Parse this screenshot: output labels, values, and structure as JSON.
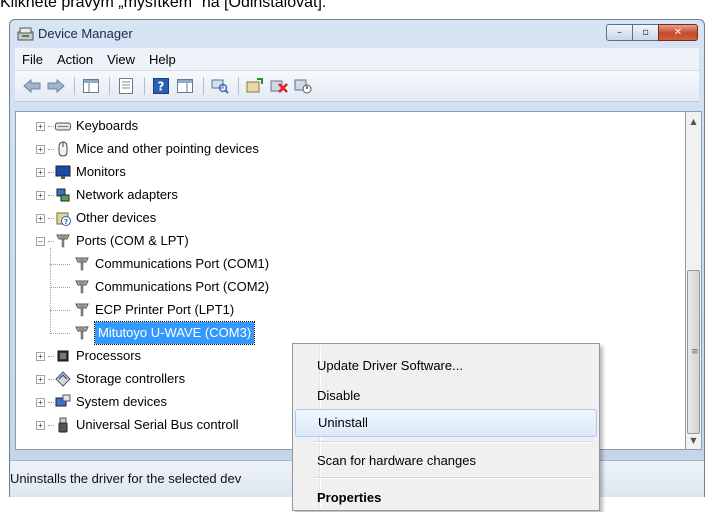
{
  "caption": "Klikněte pravým „myšítkem“ na [Odinstalovat].",
  "window": {
    "title": "Device Manager",
    "controls": {
      "minimize_glyph": "–",
      "maximize_glyph": "▫",
      "close_glyph": "✕"
    }
  },
  "menu": [
    "File",
    "Action",
    "View",
    "Help"
  ],
  "tree": {
    "items": [
      {
        "label": "Keyboards",
        "icon": "keyboard-icon",
        "expander": "+"
      },
      {
        "label": "Mice and other pointing devices",
        "icon": "mouse-icon",
        "expander": "+"
      },
      {
        "label": "Monitors",
        "icon": "monitor-icon",
        "expander": "+"
      },
      {
        "label": "Network adapters",
        "icon": "network-adapter-icon",
        "expander": "+"
      },
      {
        "label": "Other devices",
        "icon": "unknown-device-icon",
        "expander": "+"
      },
      {
        "label": "Ports (COM & LPT)",
        "icon": "port-icon",
        "expander": "–"
      },
      {
        "label": "Communications Port (COM1)",
        "icon": "port-icon"
      },
      {
        "label": "Communications Port (COM2)",
        "icon": "port-icon"
      },
      {
        "label": "ECP Printer Port (LPT1)",
        "icon": "port-icon"
      },
      {
        "label": "Mitutoyo U-WAVE (COM3)",
        "icon": "port-icon",
        "selected": true
      },
      {
        "label": "Processors",
        "icon": "processor-icon",
        "expander": "+"
      },
      {
        "label": "Storage controllers",
        "icon": "storage-controller-icon",
        "expander": "+"
      },
      {
        "label": "System devices",
        "icon": "system-devices-icon",
        "expander": "+"
      },
      {
        "label": "Universal Serial Bus controll",
        "icon": "usb-icon",
        "expander": "+"
      }
    ]
  },
  "context_menu": {
    "items": [
      {
        "label": "Update Driver Software..."
      },
      {
        "label": "Disable"
      },
      {
        "label": "Uninstall",
        "highlighted": true
      },
      {
        "label": "Scan for hardware changes"
      },
      {
        "label": "Properties",
        "bold": true
      }
    ]
  },
  "status": "Uninstalls the driver for the selected dev",
  "colors": {
    "selection": "#3399ff",
    "frame": "#c3d5ea"
  }
}
